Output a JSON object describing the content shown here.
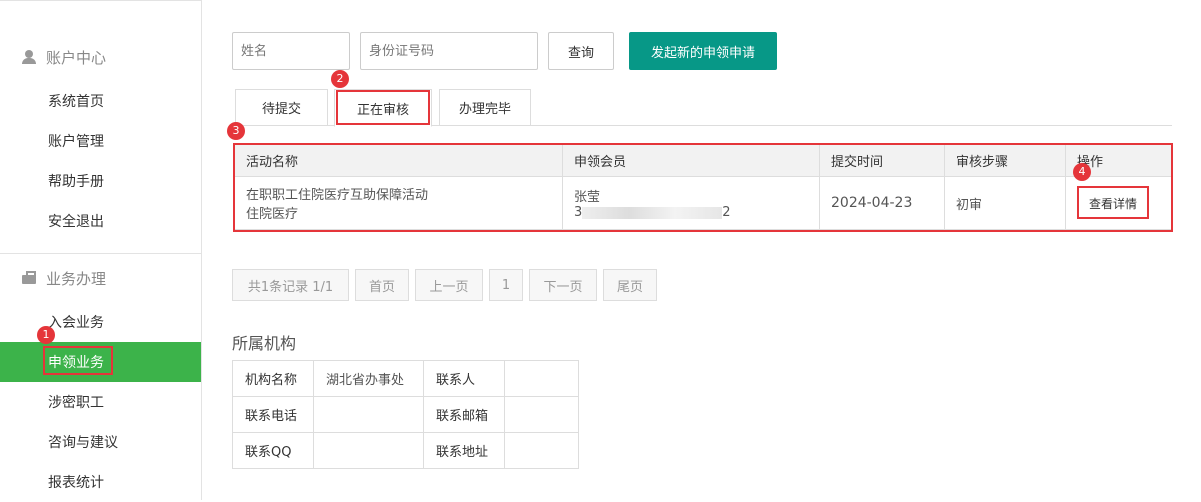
{
  "sidebar": {
    "account_section": "账户中心",
    "account_items": [
      "系统首页",
      "账户管理",
      "帮助手册",
      "安全退出"
    ],
    "business_section": "业务办理",
    "business_items": [
      "入会业务",
      "申领业务",
      "涉密职工",
      "咨询与建议",
      "报表统计"
    ],
    "active_item": "申领业务"
  },
  "search": {
    "name_placeholder": "姓名",
    "idcard_placeholder": "身份证号码",
    "query_label": "查询",
    "new_apply_label": "发起新的申领申请"
  },
  "tabs": [
    "待提交",
    "正在审核",
    "办理完毕"
  ],
  "active_tab": "正在审核",
  "table": {
    "headers": [
      "活动名称",
      "申领会员",
      "提交时间",
      "审核步骤",
      "操作"
    ],
    "rows": [
      {
        "activity_line1": "在职职工住院医疗互助保障活动",
        "activity_line2": "住院医疗",
        "member_name": "张莹",
        "member_id_prefix": "3",
        "member_id_suffix": "2",
        "submit_time": "2024-04-23",
        "step": "初审",
        "action": "查看详情"
      }
    ]
  },
  "pagination": {
    "summary": "共1条记录 1/1",
    "first": "首页",
    "prev": "上一页",
    "page": "1",
    "next": "下一页",
    "last": "尾页"
  },
  "org": {
    "title": "所属机构",
    "rows": [
      {
        "label1": "机构名称",
        "value1": "湖北省办事处",
        "label2": "联系人",
        "value2": ""
      },
      {
        "label1": "联系电话",
        "value1": "",
        "label2": "联系邮箱",
        "value2": ""
      },
      {
        "label1": "联系QQ",
        "value1": "",
        "label2": "联系地址",
        "value2": ""
      }
    ]
  },
  "annotations": [
    "1",
    "2",
    "3",
    "4"
  ],
  "colors": {
    "active_nav": "#3cb34a",
    "primary_button": "#079887",
    "annotation_red": "#e5353a"
  }
}
